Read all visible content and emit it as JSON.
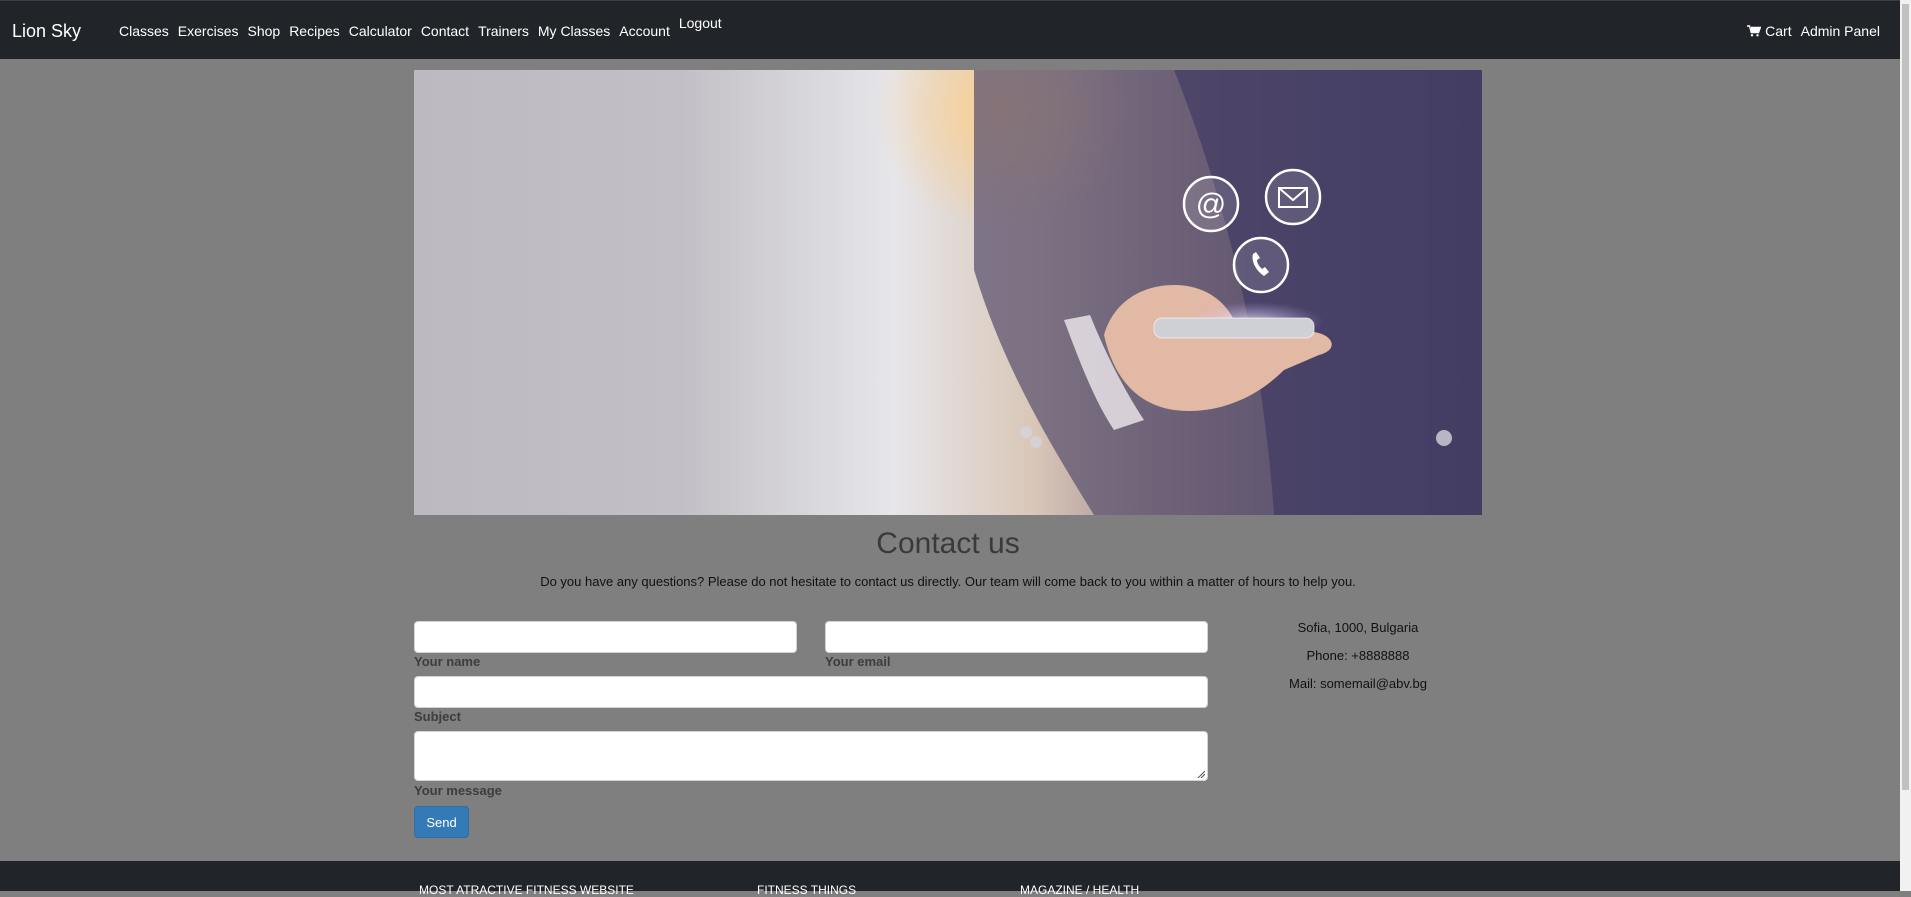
{
  "navbar": {
    "brand": "Lion Sky",
    "links": [
      "Classes",
      "Exercises",
      "Shop",
      "Recipes",
      "Calculator",
      "Contact",
      "Trainers",
      "My Classes",
      "Account",
      "Logout"
    ],
    "right": {
      "cart": "Cart",
      "admin": "Admin Panel"
    }
  },
  "contact": {
    "title": "Contact us",
    "lead": "Do you have any questions? Please do not hesitate to contact us directly. Our team will come back to you within a matter of hours to help you.",
    "form": {
      "name_label": "Your name",
      "name_value": "",
      "email_label": "Your email",
      "email_value": "",
      "subject_label": "Subject",
      "subject_value": "",
      "message_label": "Your message",
      "message_value": "",
      "send_label": "Send"
    },
    "info": {
      "address": "Sofia, 1000, Bulgaria",
      "phone": "Phone: +8888888",
      "mail": "Mail: somemail@abv.bg"
    }
  },
  "footer": {
    "headings": [
      "MOST ATRACTIVE FITNESS WEBSITE",
      "FITNESS THINGS",
      "MAGAZINE / HEALTH"
    ]
  },
  "colors": {
    "navbar_bg": "#212529",
    "page_bg": "#7f7f7f",
    "send_button": "#337ab7"
  },
  "icons": {
    "cart": "cart-icon",
    "hero_at": "at-sign-icon",
    "hero_mail": "envelope-icon",
    "hero_phone": "phone-icon"
  }
}
